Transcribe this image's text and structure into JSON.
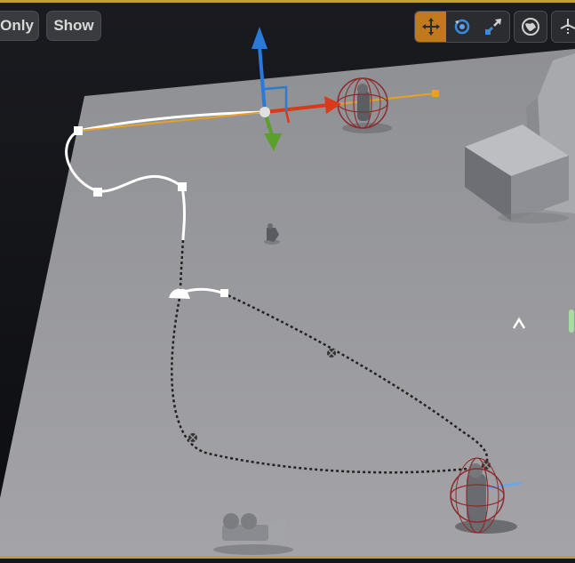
{
  "viewport": {
    "buttons": {
      "only_label": "Only",
      "show_label": "Show"
    },
    "toolbar": {
      "tools": [
        {
          "icon": "translate-icon",
          "active": true
        },
        {
          "icon": "rotate-icon",
          "active": false
        },
        {
          "icon": "scale-icon",
          "active": false
        },
        {
          "icon": "world-space-icon",
          "active": false
        },
        {
          "icon": "surface-snap-icon",
          "active": false
        }
      ]
    },
    "colors": {
      "accent": "#c07a1c",
      "gizmo_x": "#d93a1a",
      "gizmo_y": "#5aa02a",
      "gizmo_z": "#2a7ad9",
      "tangent": "#e8a21e",
      "floor": "#9a9a9e"
    }
  }
}
